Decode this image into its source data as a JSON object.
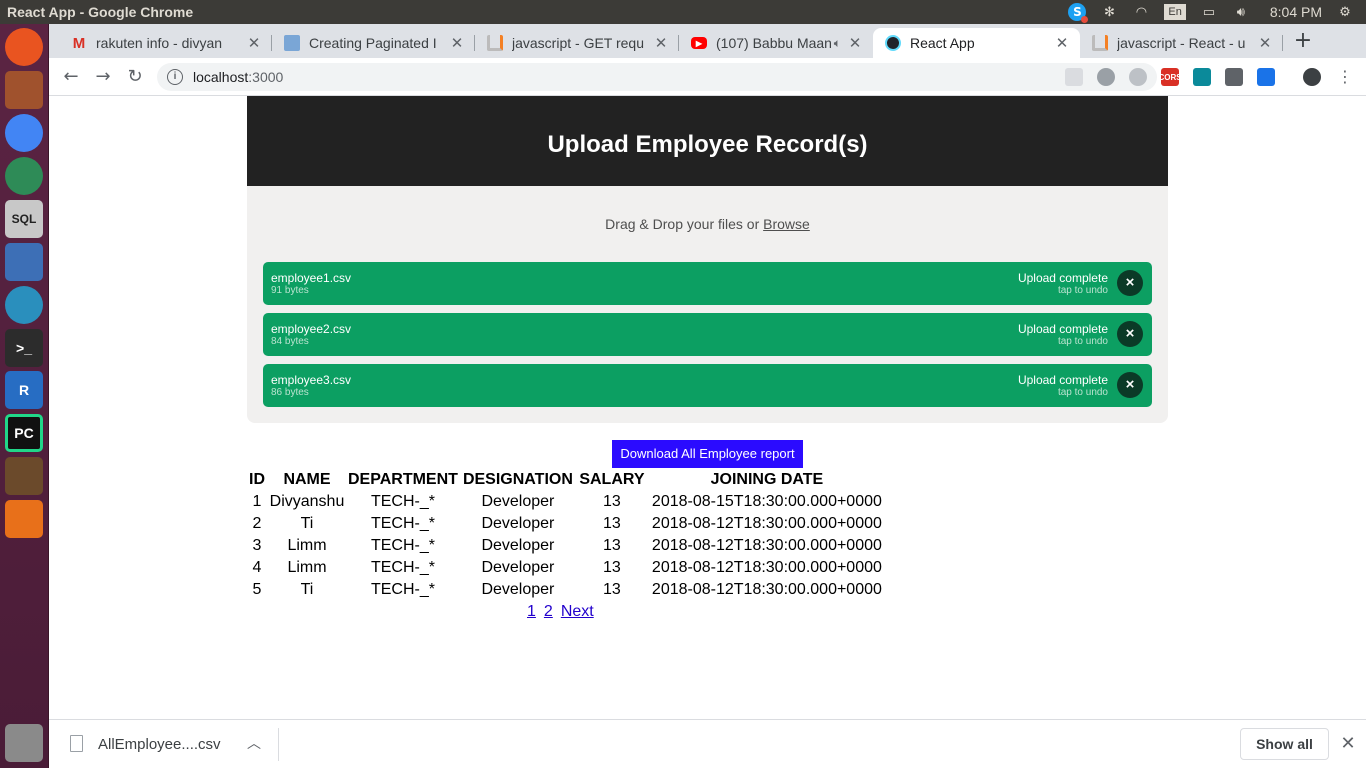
{
  "window": {
    "title": "React App - Google Chrome",
    "clock": "8:04 PM",
    "keyboard_layout": "En"
  },
  "tabs": [
    {
      "label": "rakuten info - divyan",
      "favicon": "gmail-icon",
      "color": "#d93025"
    },
    {
      "label": "Creating Paginated I",
      "favicon": "image-icon",
      "color": "#7aa6d6"
    },
    {
      "label": "javascript - GET requ",
      "favicon": "stackoverflow-icon",
      "color": "#f48024"
    },
    {
      "label": "(107) Babbu Maan",
      "favicon": "youtube-icon",
      "color": "#ff0000"
    },
    {
      "label": "React App",
      "favicon": "react-icon",
      "color": "#61dafb",
      "active": true
    },
    {
      "label": "javascript - React - u",
      "favicon": "stackoverflow-icon",
      "color": "#f48024"
    }
  ],
  "toolbar": {
    "url_host": "localhost",
    "url_port": ":3000",
    "extensions": [
      {
        "name": "bookmark-ext-icon",
        "color": "#dadce0",
        "label": ""
      },
      {
        "name": "record-ext-icon",
        "color": "#9aa0a6",
        "label": ""
      },
      {
        "name": "disc-ext-icon",
        "color": "#bdc1c6",
        "label": ""
      },
      {
        "name": "cors-ext-icon",
        "color": "#d93025",
        "label": "CORS"
      },
      {
        "name": "wave-ext-icon",
        "color": "#0b8a9a",
        "label": ""
      },
      {
        "name": "clip-ext-icon",
        "color": "#5f6368",
        "label": ""
      },
      {
        "name": "reader-ext-icon",
        "color": "#1a73e8",
        "label": ""
      }
    ]
  },
  "page": {
    "header_title": "Upload Employee Record(s)",
    "drop_prompt": "Drag & Drop your files or ",
    "browse_label": "Browse",
    "files": [
      {
        "name": "employee1.csv",
        "size": "91 bytes",
        "status": "Upload complete",
        "undo": "tap to undo"
      },
      {
        "name": "employee2.csv",
        "size": "84 bytes",
        "status": "Upload complete",
        "undo": "tap to undo"
      },
      {
        "name": "employee3.csv",
        "size": "86 bytes",
        "status": "Upload complete",
        "undo": "tap to undo"
      }
    ],
    "download_button": "Download All Employee report",
    "table": {
      "headers": [
        "ID",
        "NAME",
        "DEPARTMENT",
        "DESIGNATION",
        "SALARY",
        "JOINING DATE"
      ],
      "rows": [
        [
          "1",
          "Divyanshu",
          "TECH-_*",
          "Developer",
          "13",
          "2018-08-15T18:30:00.000+0000"
        ],
        [
          "2",
          "Ti",
          "TECH-_*",
          "Developer",
          "13",
          "2018-08-12T18:30:00.000+0000"
        ],
        [
          "3",
          "Limm",
          "TECH-_*",
          "Developer",
          "13",
          "2018-08-12T18:30:00.000+0000"
        ],
        [
          "4",
          "Limm",
          "TECH-_*",
          "Developer",
          "13",
          "2018-08-12T18:30:00.000+0000"
        ],
        [
          "5",
          "Ti",
          "TECH-_*",
          "Developer",
          "13",
          "2018-08-12T18:30:00.000+0000"
        ]
      ]
    },
    "pagination": {
      "pages": [
        "1",
        "2"
      ],
      "next": "Next"
    }
  },
  "download_shelf": {
    "filename": "AllEmployee....csv",
    "show_all": "Show all"
  },
  "launcher": [
    {
      "name": "ubuntu-dash-icon",
      "color": "#e95420",
      "label": ""
    },
    {
      "name": "file-manager-icon",
      "color": "#a0522d",
      "label": ""
    },
    {
      "name": "chrome-icon",
      "color": "#4285f4",
      "label": ""
    },
    {
      "name": "atom-icon",
      "color": "#2e8b57",
      "label": ""
    },
    {
      "name": "sql-icon",
      "color": "#c8c8c8",
      "label": "SQL"
    },
    {
      "name": "shutter-icon",
      "color": "#3d6fb6",
      "label": ""
    },
    {
      "name": "browser-icon",
      "color": "#2a8fbd",
      "label": ""
    },
    {
      "name": "terminal-icon",
      "color": "#2c2c2c",
      "label": ">_"
    },
    {
      "name": "r-icon",
      "color": "#276dc3",
      "label": "R"
    },
    {
      "name": "pycharm-icon",
      "color": "#21d789",
      "label": "PC"
    },
    {
      "name": "ide-icon",
      "color": "#6b4a2b",
      "label": ""
    },
    {
      "name": "tools-icon",
      "color": "#e8701a",
      "label": ""
    },
    {
      "name": "trash-icon",
      "color": "#8a8a8a",
      "label": ""
    }
  ]
}
